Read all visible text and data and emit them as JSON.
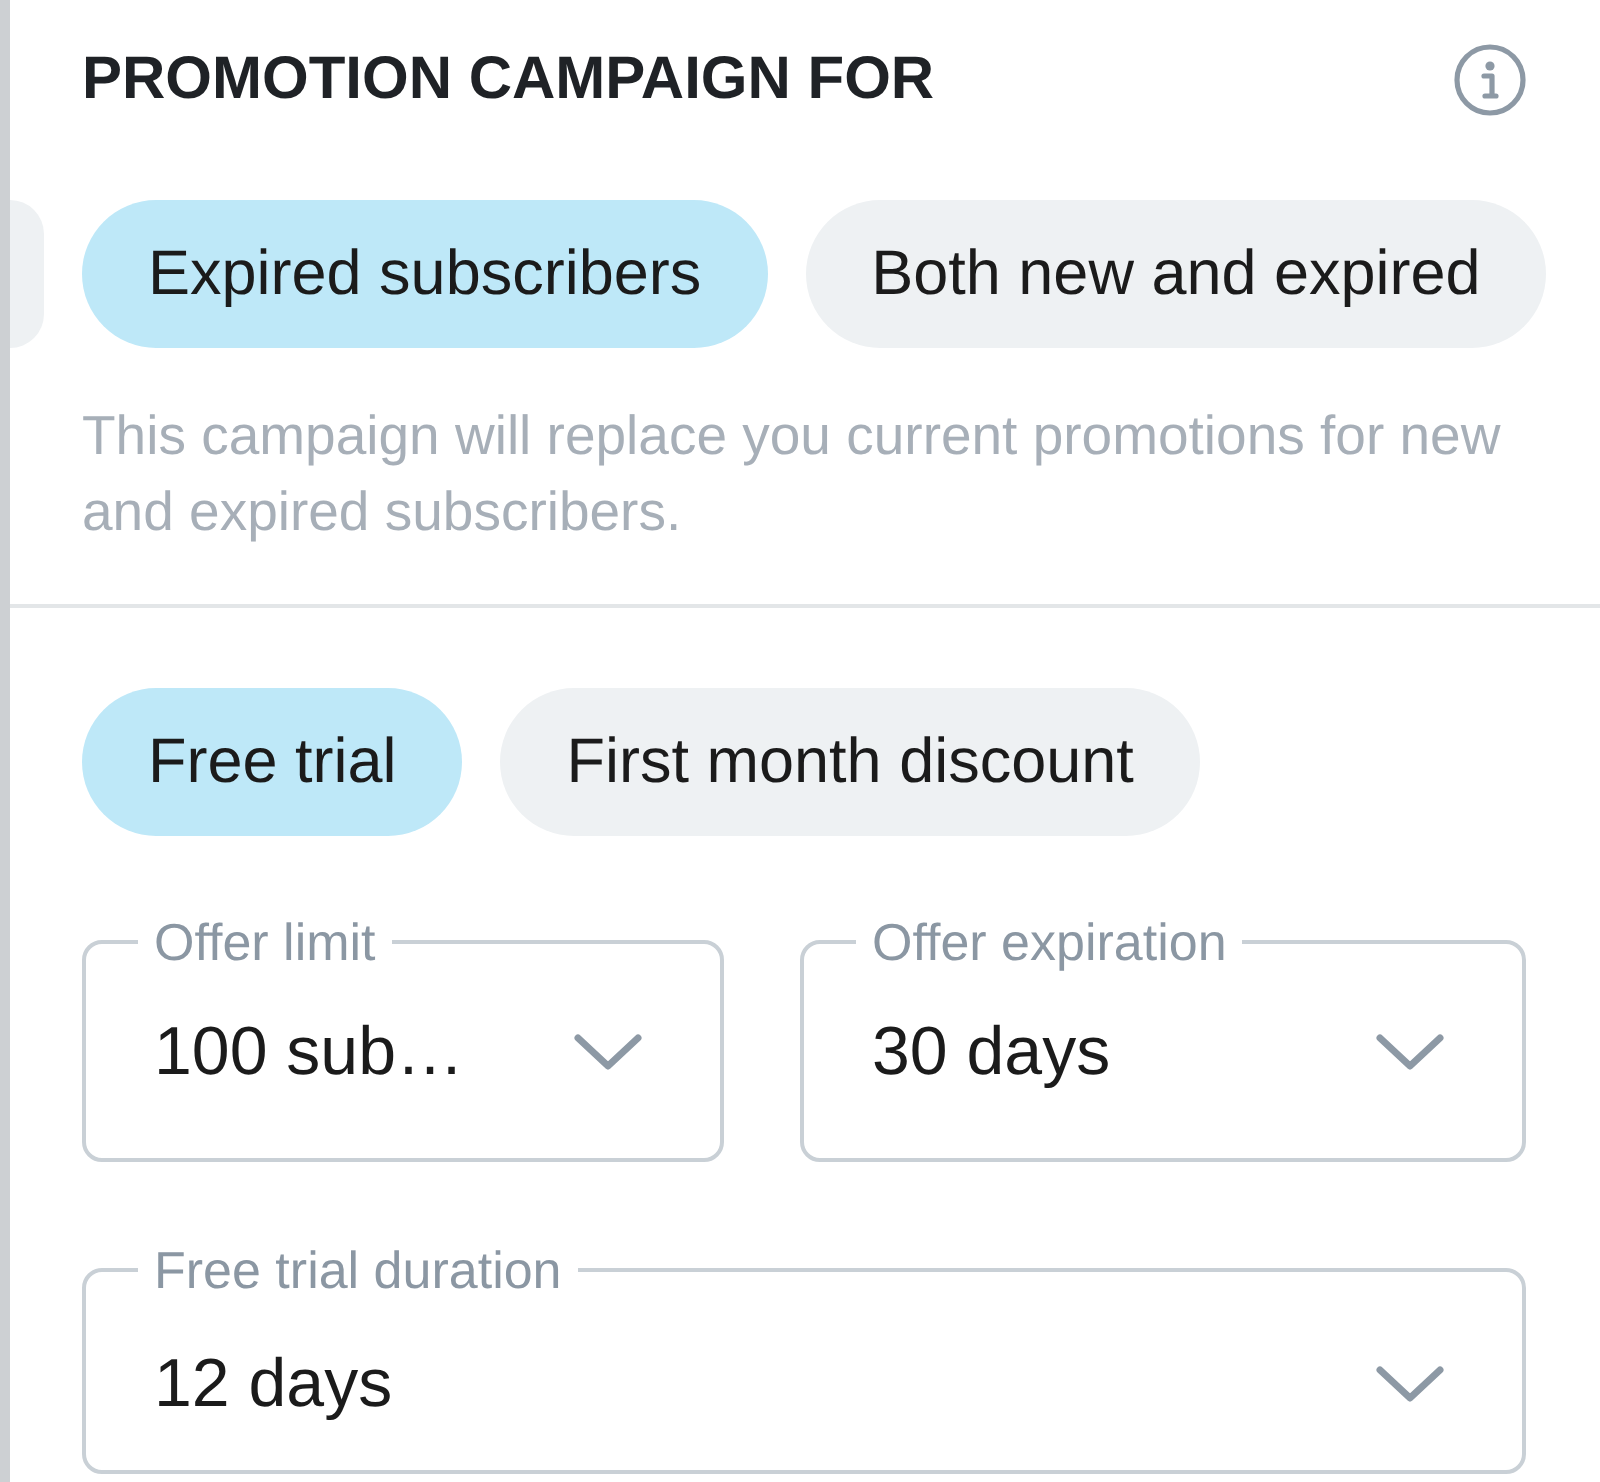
{
  "header": {
    "title": "PROMOTION CAMPAIGN FOR"
  },
  "audience_options": [
    {
      "selected": false
    },
    {
      "label": "Expired subscribers",
      "selected": true
    },
    {
      "label": "Both new and expired",
      "selected": false
    }
  ],
  "audience_note": "This campaign will replace you current promotions for new and expired subscribers.",
  "offer_types": [
    {
      "label": "Free trial",
      "selected": true
    },
    {
      "label": "First month discount",
      "selected": false
    }
  ],
  "field_rows": [
    [
      {
        "label": "Offer limit",
        "value": "100 sub…"
      },
      {
        "label": "Offer expiration",
        "value": "30 days"
      }
    ],
    [
      {
        "label": "Free trial duration",
        "value": "12 days"
      }
    ]
  ]
}
